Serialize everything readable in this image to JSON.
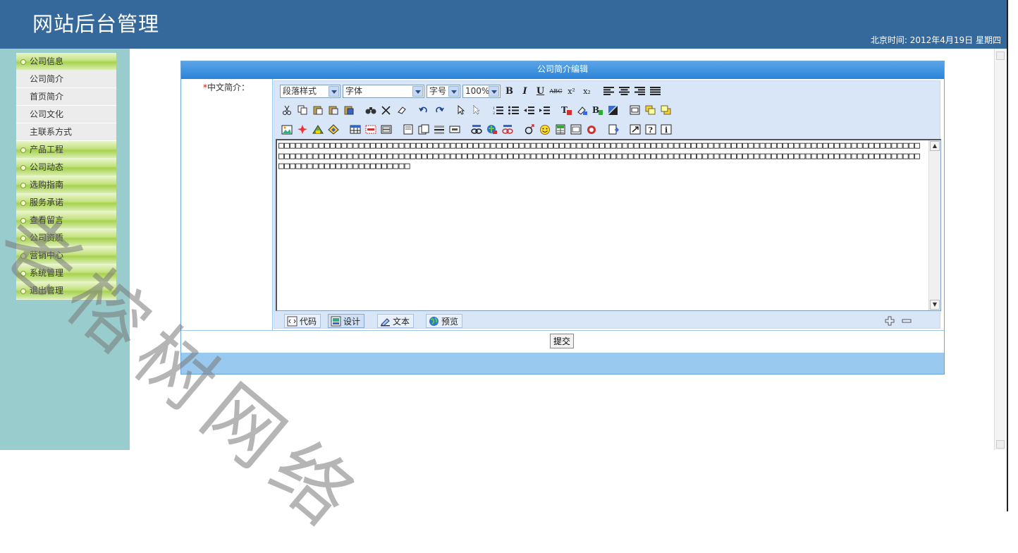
{
  "header": {
    "title": "网站后台管理",
    "clock": "北京时间: 2012年4月19日 星期四"
  },
  "sidebar": {
    "groups": [
      {
        "label": "公司信息",
        "sub": [
          "公司简介",
          "首页简介",
          "公司文化",
          "主联系方式"
        ]
      },
      {
        "label": "产品工程"
      },
      {
        "label": "公司动态"
      },
      {
        "label": "选购指南"
      },
      {
        "label": "服务承诺"
      },
      {
        "label": "查看留言"
      },
      {
        "label": "公司资质"
      },
      {
        "label": "营销中心"
      },
      {
        "label": "系统管理"
      },
      {
        "label": "退出管理"
      }
    ]
  },
  "panel": {
    "title": "公司简介编辑",
    "field_label": "中文简介：",
    "required_mark": "*"
  },
  "editor": {
    "selects": {
      "paragraph": "段落样式",
      "font": "字体",
      "size": "字号",
      "zoom": "100%"
    },
    "bold": "B",
    "italic": "I",
    "underline": "U",
    "strike": "ABC",
    "superscript": "x²",
    "subscript": "x₂",
    "content": "□□□□□□□□□□□□□□□□□□□□□□□□□□□□□□□□□□□□□□□□□□□□□□□□□□□□□□□□□□□□□□□□□□□□□□□□□□□□□□□□□□□□□□□□□□□□□□□□□□□□□□□□□□□□□□□□□□□□□□□□□□□□□□□□□□□□□□□□□□□□□□□□□□□□□□□□□□□□□□□□□□□□□□□□□□□□□□□□□□□□□□□□□□□□□□□□□□□□□□□□□□□□□□□□□□□□□□□□□□□□□□□□□□□□□□□□□□□□□□□□□□□□□□□",
    "modes": {
      "code": "代码",
      "design": "设计",
      "text": "文本",
      "preview": "预览"
    }
  },
  "submit_label": "提交",
  "watermark": "老榕树网络",
  "colors": {
    "header_bg": "#35699b",
    "sidebar_bg": "#99cccc",
    "panel_title_bg": "#2b84d8",
    "panel_footer_bg": "#99c9ee",
    "toolbar_bg": "#d8e6f8"
  }
}
